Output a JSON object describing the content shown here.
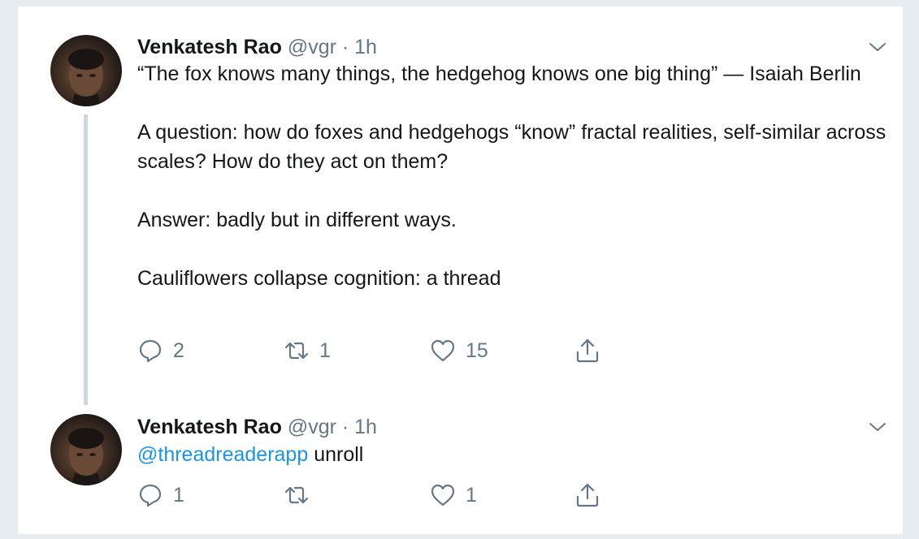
{
  "tweets": [
    {
      "name": "Venkatesh Rao",
      "handle": "@vgr",
      "separator": "·",
      "time": "1h",
      "paragraphs": [
        "“The fox knows many things, the hedgehog knows one big thing” — Isaiah Berlin",
        "A question: how do foxes and hedgehogs “know” fractal realities, self-similar across scales? How do they act on them?",
        "Answer: badly but in different ways.",
        "Cauliflowers collapse cognition: a thread"
      ],
      "replies": "2",
      "retweets": "1",
      "likes": "15"
    },
    {
      "name": "Venkatesh Rao",
      "handle": "@vgr",
      "separator": "·",
      "time": "1h",
      "mention": "@threadreaderapp",
      "body": " unroll",
      "replies": "1",
      "retweets": "",
      "likes": "1"
    }
  ],
  "icons": {
    "reply": "reply-icon",
    "retweet": "retweet-icon",
    "like": "heart-icon",
    "share": "share-icon",
    "caret": "chevron-down-icon"
  },
  "colors": {
    "background": "#e6ecf0",
    "text": "#14171a",
    "secondary": "#657786",
    "link": "#1b95e0",
    "thread_line": "#ccd6dd"
  }
}
